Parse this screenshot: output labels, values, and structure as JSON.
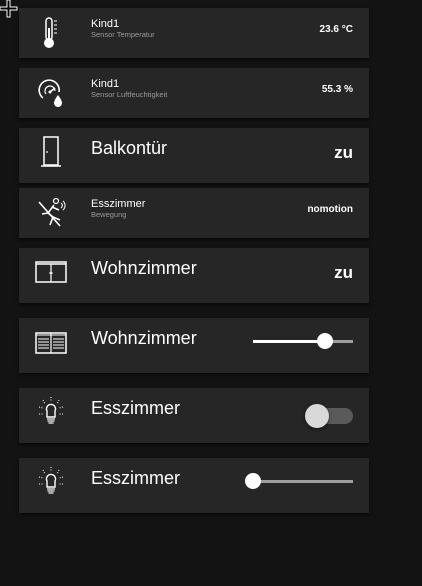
{
  "colors": {
    "background": "#131313",
    "panel": "#262626",
    "text": "#ffffff",
    "subtext": "#9a9a9a",
    "slider_track": "#9e9e9e",
    "toggle_track": "#5a5a5a"
  },
  "cards": [
    {
      "icon": "thermometer-icon",
      "title": "Kind1",
      "subtitle": "Sensor Temperatur",
      "value": "23.6 °C"
    },
    {
      "icon": "humidity-gauge-icon",
      "title": "Kind1",
      "subtitle": "Sensor Luftfeuchtigkeit",
      "value": "55.3 %"
    },
    {
      "icon": "door-icon",
      "title": "Balkontür",
      "value": "zu"
    },
    {
      "icon": "no-motion-icon",
      "title": "Esszimmer",
      "subtitle": "Bewegung",
      "value": "nomotion"
    },
    {
      "icon": "window-icon",
      "title": "Wohnzimmer",
      "value": "zu"
    },
    {
      "icon": "blinds-icon",
      "title": "Wohnzimmer",
      "slider_level": 0.72
    },
    {
      "icon": "light-bulb-icon",
      "title": "Esszimmer",
      "switch_on": false
    },
    {
      "icon": "light-bulb-icon",
      "title": "Esszimmer",
      "slider_level": 0.0
    }
  ]
}
